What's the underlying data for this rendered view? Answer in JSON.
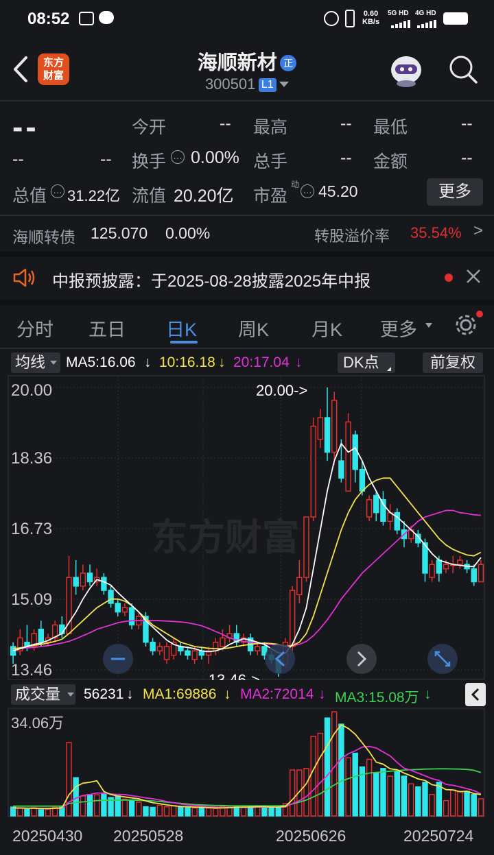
{
  "status": {
    "time": "08:52",
    "net_speed_value": "0.60",
    "net_speed_unit": "KB/s",
    "sig1": "5G HD",
    "sig2": "4G HD"
  },
  "header": {
    "logo_line1": "东方",
    "logo_line2": "财富",
    "title": "海顺新材",
    "badge": "正",
    "code": "300501",
    "level": "L1"
  },
  "quote": {
    "price": "--",
    "change": "--",
    "change_pct": "--",
    "open_label": "今开",
    "open_value": "--",
    "high_label": "最高",
    "high_value": "--",
    "low_label": "最低",
    "low_value": "--",
    "turnover_label": "换手",
    "turnover_value": "0.00%",
    "volume_label": "总手",
    "volume_value": "--",
    "amount_label": "金额",
    "amount_value": "--",
    "mktcap_label": "总值",
    "mktcap_value": "31.22亿",
    "float_label": "流值",
    "float_value": "20.20亿",
    "pe_label": "市盈",
    "pe_sup": "动",
    "pe_value": "45.20",
    "more_button": "更多"
  },
  "bond": {
    "name": "海顺转债",
    "price": "125.070",
    "change": "0.00%",
    "premium_label": "转股溢价率",
    "premium_value": "35.54%"
  },
  "notice": {
    "text": "中报预披露：于2025-08-28披露2025年中报"
  },
  "tabs": [
    "分时",
    "五日",
    "日K",
    "周K",
    "月K",
    "更多"
  ],
  "active_tab": "日K",
  "kline_bar": {
    "ma_selector": "均线",
    "ma5": "MA5:16.06",
    "ma10": "10:16.18",
    "ma20": "20:17.04",
    "dk_button": "DK点",
    "adjust_button": "前复权"
  },
  "watermark": "东方财富",
  "colors": {
    "up": "#e0302f",
    "down": "#2fe6ea",
    "ma5": "#ffffff",
    "ma10": "#f4e34a",
    "ma20": "#e030d6",
    "vma3": "#39d353",
    "accent": "#4a90e2"
  },
  "volume_bar": {
    "selector": "成交量",
    "vol": "56231",
    "ma1": "MA1:69886",
    "ma2": "MA2:72014",
    "ma3": "MA3:15.08万",
    "ylabel": "34.06万"
  },
  "chart_data": {
    "type": "candlestick",
    "y_ticks": [
      "20.00",
      "18.36",
      "16.73",
      "15.09",
      "13.46"
    ],
    "ylim": [
      13.46,
      20.0
    ],
    "max_marker": "20.00->",
    "min_marker": "13.46->",
    "x_ticks": [
      "20250430",
      "20250528",
      "20250626",
      "20250724"
    ],
    "candles": [
      {
        "o": 14.0,
        "c": 13.8,
        "h": 14.1,
        "l": 13.6
      },
      {
        "o": 13.9,
        "c": 14.2,
        "h": 14.4,
        "l": 13.8
      },
      {
        "o": 14.1,
        "c": 14.0,
        "h": 14.5,
        "l": 13.9
      },
      {
        "o": 14.0,
        "c": 14.3,
        "h": 14.4,
        "l": 13.9
      },
      {
        "o": 14.4,
        "c": 14.1,
        "h": 14.6,
        "l": 14.0
      },
      {
        "o": 14.1,
        "c": 14.2,
        "h": 14.3,
        "l": 14.0
      },
      {
        "o": 14.2,
        "c": 14.5,
        "h": 14.6,
        "l": 14.1
      },
      {
        "o": 14.5,
        "c": 14.3,
        "h": 14.7,
        "l": 14.2
      },
      {
        "o": 14.3,
        "c": 15.6,
        "h": 16.1,
        "l": 14.3
      },
      {
        "o": 15.6,
        "c": 15.4,
        "h": 16.0,
        "l": 15.2
      },
      {
        "o": 15.4,
        "c": 15.7,
        "h": 15.9,
        "l": 15.3
      },
      {
        "o": 15.7,
        "c": 15.5,
        "h": 15.9,
        "l": 15.4
      },
      {
        "o": 15.5,
        "c": 15.6,
        "h": 15.8,
        "l": 15.4
      },
      {
        "o": 15.6,
        "c": 15.3,
        "h": 15.7,
        "l": 15.2
      },
      {
        "o": 15.3,
        "c": 15.0,
        "h": 15.4,
        "l": 14.9
      },
      {
        "o": 15.0,
        "c": 14.8,
        "h": 15.1,
        "l": 14.7
      },
      {
        "o": 14.8,
        "c": 14.9,
        "h": 15.0,
        "l": 14.7
      },
      {
        "o": 14.9,
        "c": 14.5,
        "h": 15.0,
        "l": 14.4
      },
      {
        "o": 14.5,
        "c": 14.7,
        "h": 14.8,
        "l": 14.4
      },
      {
        "o": 14.7,
        "c": 14.1,
        "h": 14.8,
        "l": 14.0
      },
      {
        "o": 14.1,
        "c": 13.9,
        "h": 14.2,
        "l": 13.8
      },
      {
        "o": 13.9,
        "c": 14.0,
        "h": 14.1,
        "l": 13.8
      },
      {
        "o": 13.7,
        "c": 14.0,
        "h": 14.1,
        "l": 13.6
      },
      {
        "o": 13.8,
        "c": 14.1,
        "h": 14.2,
        "l": 13.7
      },
      {
        "o": 14.0,
        "c": 13.9,
        "h": 14.1,
        "l": 13.8
      },
      {
        "o": 13.9,
        "c": 13.8,
        "h": 14.0,
        "l": 13.7
      },
      {
        "o": 13.7,
        "c": 13.9,
        "h": 14.0,
        "l": 13.6
      },
      {
        "o": 13.9,
        "c": 13.8,
        "h": 14.0,
        "l": 13.7
      },
      {
        "o": 13.8,
        "c": 13.9,
        "h": 14.0,
        "l": 13.6
      },
      {
        "o": 13.9,
        "c": 14.1,
        "h": 14.2,
        "l": 13.8
      },
      {
        "o": 14.0,
        "c": 14.2,
        "h": 14.4,
        "l": 13.9
      },
      {
        "o": 14.2,
        "c": 14.3,
        "h": 14.5,
        "l": 14.1
      },
      {
        "o": 14.3,
        "c": 14.1,
        "h": 14.5,
        "l": 14.0
      },
      {
        "o": 14.1,
        "c": 14.2,
        "h": 14.3,
        "l": 14.0
      },
      {
        "o": 14.2,
        "c": 13.9,
        "h": 14.3,
        "l": 13.8
      },
      {
        "o": 13.9,
        "c": 14.0,
        "h": 14.1,
        "l": 13.8
      },
      {
        "o": 14.0,
        "c": 13.8,
        "h": 14.1,
        "l": 13.7
      },
      {
        "o": 13.8,
        "c": 13.7,
        "h": 13.9,
        "l": 13.6
      },
      {
        "o": 13.7,
        "c": 13.4,
        "h": 13.8,
        "l": 13.3
      },
      {
        "o": 13.6,
        "c": 14.1,
        "h": 14.2,
        "l": 13.5
      },
      {
        "o": 14.0,
        "c": 15.3,
        "h": 15.4,
        "l": 13.9
      },
      {
        "o": 15.2,
        "c": 15.6,
        "h": 16.0,
        "l": 15.0
      },
      {
        "o": 15.6,
        "c": 17.0,
        "h": 17.0,
        "l": 15.5
      },
      {
        "o": 17.0,
        "c": 19.1,
        "h": 19.3,
        "l": 16.9
      },
      {
        "o": 18.8,
        "c": 19.3,
        "h": 19.5,
        "l": 18.6
      },
      {
        "o": 19.3,
        "c": 18.5,
        "h": 20.0,
        "l": 18.3
      },
      {
        "o": 18.5,
        "c": 19.7,
        "h": 19.9,
        "l": 18.2
      },
      {
        "o": 18.3,
        "c": 17.9,
        "h": 18.8,
        "l": 17.8
      },
      {
        "o": 17.6,
        "c": 19.2,
        "h": 19.4,
        "l": 17.6
      },
      {
        "o": 18.9,
        "c": 18.1,
        "h": 19.0,
        "l": 17.8
      },
      {
        "o": 18.1,
        "c": 17.6,
        "h": 18.3,
        "l": 17.5
      },
      {
        "o": 17.0,
        "c": 17.4,
        "h": 17.5,
        "l": 16.9
      },
      {
        "o": 17.5,
        "c": 17.1,
        "h": 17.6,
        "l": 16.9
      },
      {
        "o": 17.4,
        "c": 16.9,
        "h": 17.6,
        "l": 16.8
      },
      {
        "o": 16.9,
        "c": 17.1,
        "h": 17.3,
        "l": 16.7
      },
      {
        "o": 17.1,
        "c": 16.7,
        "h": 17.2,
        "l": 16.6
      },
      {
        "o": 16.7,
        "c": 16.5,
        "h": 16.9,
        "l": 16.3
      },
      {
        "o": 16.5,
        "c": 16.7,
        "h": 16.8,
        "l": 16.4
      },
      {
        "o": 16.6,
        "c": 16.4,
        "h": 16.7,
        "l": 16.3
      },
      {
        "o": 16.4,
        "c": 15.7,
        "h": 16.5,
        "l": 15.5
      },
      {
        "o": 15.6,
        "c": 15.9,
        "h": 16.0,
        "l": 15.5
      },
      {
        "o": 16.0,
        "c": 15.7,
        "h": 16.1,
        "l": 15.5
      },
      {
        "o": 15.8,
        "c": 15.9,
        "h": 16.0,
        "l": 15.7
      },
      {
        "o": 15.9,
        "c": 15.9,
        "h": 16.1,
        "l": 15.7
      },
      {
        "o": 15.9,
        "c": 16.0,
        "h": 16.1,
        "l": 15.8
      },
      {
        "o": 15.9,
        "c": 15.8,
        "h": 16.0,
        "l": 15.7
      },
      {
        "o": 15.8,
        "c": 15.5,
        "h": 15.9,
        "l": 15.4
      },
      {
        "o": 15.5,
        "c": 15.9,
        "h": 16.0,
        "l": 15.5
      }
    ],
    "ma5": [
      13.9,
      13.95,
      14.0,
      14.05,
      14.08,
      14.14,
      14.22,
      14.3,
      14.55,
      14.8,
      15.1,
      15.35,
      15.55,
      15.5,
      15.42,
      15.25,
      15.1,
      14.95,
      14.8,
      14.6,
      14.45,
      14.3,
      14.15,
      14.05,
      14.0,
      13.98,
      13.95,
      13.9,
      13.88,
      13.9,
      13.95,
      14.05,
      14.12,
      14.18,
      14.15,
      14.1,
      14.05,
      13.95,
      13.85,
      13.85,
      14.05,
      14.4,
      14.9,
      15.8,
      16.7,
      17.6,
      18.3,
      18.7,
      18.5,
      18.6,
      18.3,
      17.9,
      17.6,
      17.3,
      17.1,
      17.0,
      16.85,
      16.7,
      16.55,
      16.35,
      16.15,
      16.0,
      15.95,
      15.9,
      15.88,
      15.86,
      15.85,
      16.06
    ],
    "ma10": [
      13.95,
      13.97,
      14.0,
      14.03,
      14.05,
      14.08,
      14.12,
      14.17,
      14.3,
      14.45,
      14.6,
      14.75,
      14.9,
      15.0,
      15.1,
      15.1,
      15.05,
      14.95,
      14.8,
      14.65,
      14.5,
      14.4,
      14.3,
      14.2,
      14.1,
      14.05,
      14.0,
      13.98,
      13.96,
      13.95,
      13.95,
      13.97,
      14.0,
      14.03,
      14.05,
      14.07,
      14.08,
      14.07,
      14.05,
      14.0,
      14.02,
      14.1,
      14.3,
      14.7,
      15.2,
      15.7,
      16.2,
      16.7,
      17.1,
      17.4,
      17.6,
      17.75,
      17.85,
      17.9,
      17.9,
      17.7,
      17.5,
      17.3,
      17.1,
      16.9,
      16.7,
      16.5,
      16.35,
      16.25,
      16.18,
      16.12,
      16.1,
      16.18
    ],
    "ma20": [
      13.95,
      13.96,
      13.97,
      13.98,
      14.0,
      14.02,
      14.05,
      14.08,
      14.12,
      14.18,
      14.25,
      14.32,
      14.4,
      14.45,
      14.5,
      14.55,
      14.58,
      14.6,
      14.6,
      14.6,
      14.6,
      14.6,
      14.59,
      14.58,
      14.57,
      14.55,
      14.52,
      14.48,
      14.42,
      14.35,
      14.28,
      14.2,
      14.15,
      14.12,
      14.1,
      14.08,
      14.06,
      14.05,
      14.03,
      14.02,
      14.02,
      14.05,
      14.12,
      14.25,
      14.42,
      14.62,
      14.85,
      15.1,
      15.3,
      15.5,
      15.7,
      15.85,
      16.0,
      16.15,
      16.3,
      16.45,
      16.6,
      16.75,
      16.9,
      17.0,
      17.05,
      17.1,
      17.15,
      17.15,
      17.1,
      17.08,
      17.05,
      17.04
    ],
    "volume": [
      2.9,
      2.6,
      2.1,
      2.7,
      2.0,
      2.2,
      2.8,
      3.0,
      24.0,
      12.5,
      6.5,
      7.0,
      6.9,
      7.5,
      6.0,
      6.5,
      5.5,
      5.0,
      4.5,
      3.0,
      2.8,
      3.5,
      3.0,
      3.4,
      3.0,
      2.7,
      2.6,
      2.5,
      2.6,
      2.4,
      3.1,
      3.2,
      3.2,
      2.8,
      3.3,
      3.0,
      2.9,
      2.8,
      2.8,
      4.0,
      15.0,
      15.0,
      15.5,
      26.0,
      27.0,
      32.0,
      34.06,
      30.0,
      19.0,
      20.5,
      16.0,
      18.5,
      14.0,
      15.5,
      13.0,
      14.5,
      13.0,
      10.5,
      9.5,
      11.0,
      7.0,
      11.0,
      5.0,
      8.5,
      8.0,
      8.0,
      7.0,
      5.6
    ],
    "vma1": [
      2.6,
      2.6,
      2.5,
      2.5,
      2.4,
      2.4,
      2.5,
      2.6,
      6.9,
      9.6,
      10.7,
      11.0,
      11.5,
      8.0,
      7.0,
      6.5,
      6.2,
      5.9,
      5.6,
      4.9,
      4.3,
      4.0,
      3.6,
      3.3,
      3.1,
      3.0,
      2.9,
      2.8,
      2.7,
      2.6,
      2.6,
      2.7,
      2.8,
      2.9,
      2.9,
      3.0,
      3.0,
      2.9,
      2.9,
      3.1,
      5.3,
      7.9,
      10.5,
      15.1,
      19.3,
      22.9,
      26.9,
      29.8,
      28.6,
      26.7,
      23.9,
      21.0,
      17.6,
      16.9,
      15.4,
      15.1,
      14.0,
      13.1,
      12.1,
      11.6,
      10.2,
      9.8,
      8.6,
      8.5,
      7.9,
      8.1,
      7.3,
      7.0
    ],
    "vma2": [
      2.5,
      2.5,
      2.5,
      2.5,
      2.5,
      2.5,
      2.5,
      2.5,
      4.5,
      5.8,
      6.7,
      7.0,
      7.5,
      7.4,
      7.2,
      7.0,
      7.0,
      6.6,
      6.3,
      5.9,
      5.6,
      5.2,
      4.7,
      4.3,
      3.9,
      3.6,
      3.4,
      3.2,
      3.0,
      2.9,
      2.8,
      2.8,
      2.8,
      2.8,
      2.8,
      2.9,
      2.9,
      2.9,
      2.9,
      2.9,
      4.0,
      5.0,
      6.3,
      8.5,
      10.9,
      13.2,
      16.0,
      18.7,
      20.3,
      21.3,
      22.5,
      22.7,
      22.2,
      20.9,
      19.6,
      17.5,
      15.6,
      14.9,
      14.0,
      13.1,
      12.2,
      11.6,
      10.3,
      10.0,
      9.5,
      8.9,
      8.3,
      7.2
    ],
    "vma3": [
      3.2,
      3.2,
      3.2,
      3.2,
      3.2,
      3.2,
      3.2,
      3.2,
      4.0,
      4.4,
      4.6,
      4.8,
      5.0,
      5.1,
      5.2,
      5.2,
      5.2,
      5.2,
      5.1,
      5.0,
      4.9,
      4.7,
      4.5,
      4.3,
      4.1,
      3.9,
      3.7,
      3.6,
      3.5,
      3.4,
      3.4,
      3.3,
      3.3,
      3.3,
      3.3,
      3.3,
      3.3,
      3.3,
      3.3,
      3.4,
      3.9,
      4.5,
      5.2,
      6.2,
      7.3,
      8.7,
      10.1,
      11.4,
      12.2,
      12.9,
      13.5,
      14.0,
      14.2,
      14.4,
      14.6,
      14.8,
      15.0,
      15.1,
      15.2,
      15.3,
      15.35,
      15.4,
      15.4,
      15.35,
      15.3,
      15.2,
      14.9,
      14.2
    ]
  }
}
